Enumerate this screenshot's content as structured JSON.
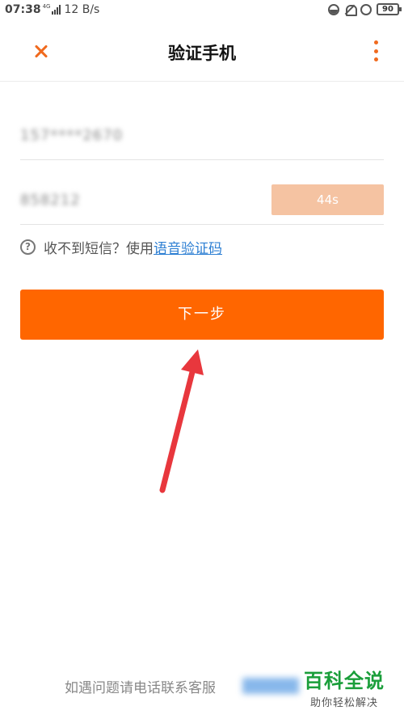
{
  "status_bar": {
    "time": "07:38",
    "network": "4G",
    "speed": "12 B/s",
    "battery": "90"
  },
  "header": {
    "title": "验证手机"
  },
  "form": {
    "phone_value": "157****2670",
    "code_value": "858212",
    "countdown": "44s",
    "hint_text": "收不到短信？使用",
    "voice_link": "语音验证码",
    "next_button": "下一步"
  },
  "footer": {
    "text": "如遇问题请电话联系客服"
  },
  "watermark": {
    "title": "百科全说",
    "subtitle": "助你轻松解决"
  },
  "colors": {
    "accent": "#ff6600",
    "link": "#2d7fd3",
    "countdown_bg": "#f5c3a2",
    "annotation_arrow": "#e8373d",
    "watermark": "#1a9e3a"
  }
}
